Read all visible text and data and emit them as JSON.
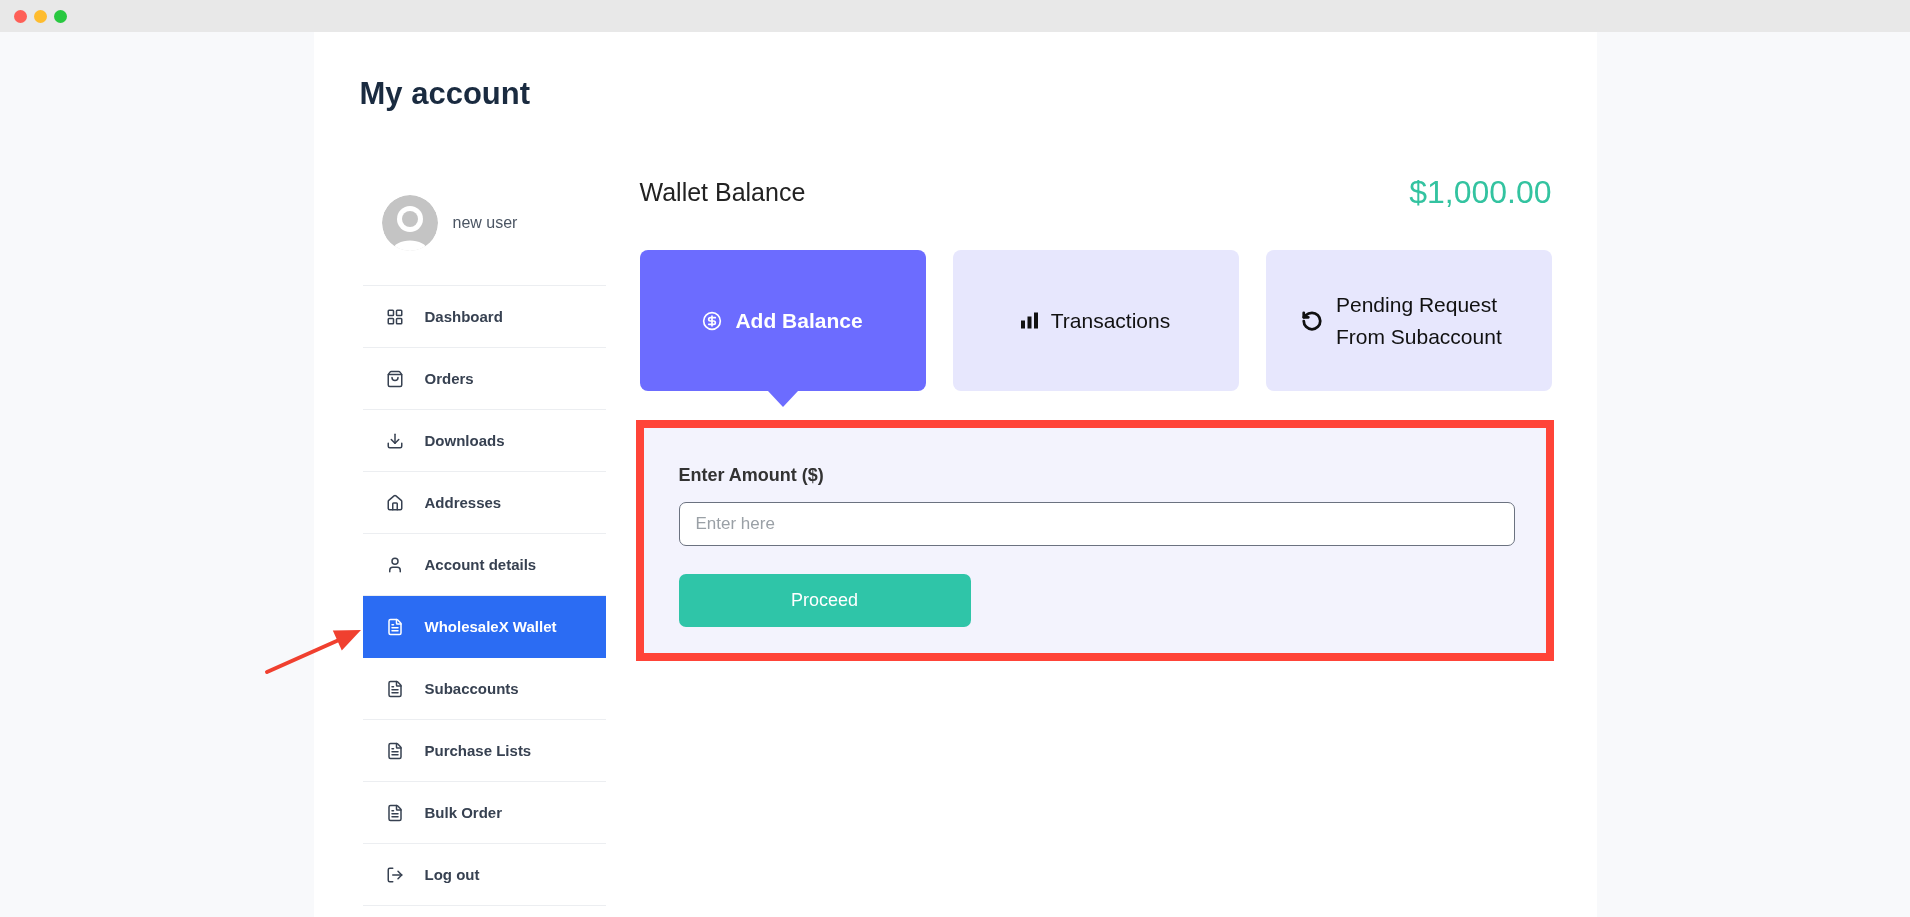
{
  "page": {
    "title": "My account"
  },
  "sidebar": {
    "user": {
      "name": "new user"
    },
    "items": [
      {
        "label": "Dashboard",
        "kind": "dashboard",
        "selected": false
      },
      {
        "label": "Orders",
        "kind": "orders",
        "selected": false
      },
      {
        "label": "Downloads",
        "kind": "downloads",
        "selected": false
      },
      {
        "label": "Addresses",
        "kind": "addresses",
        "selected": false
      },
      {
        "label": "Account details",
        "kind": "account",
        "selected": false
      },
      {
        "label": "WholesaleX Wallet",
        "kind": "page",
        "selected": true
      },
      {
        "label": "Subaccounts",
        "kind": "page",
        "selected": false
      },
      {
        "label": "Purchase Lists",
        "kind": "page",
        "selected": false
      },
      {
        "label": "Bulk Order",
        "kind": "page",
        "selected": false
      },
      {
        "label": "Log out",
        "kind": "logout",
        "selected": false
      }
    ]
  },
  "wallet": {
    "title": "Wallet Balance",
    "balance": "$1,000.00",
    "tabs": [
      {
        "label": "Add Balance",
        "kind": "add",
        "selected": true
      },
      {
        "label": "Transactions",
        "kind": "transactions",
        "selected": false
      },
      {
        "label": "Pending Request From Subaccount",
        "kind": "pending",
        "selected": false
      }
    ],
    "form": {
      "label": "Enter Amount ($)",
      "placeholder": "Enter here",
      "button": "Proceed"
    }
  }
}
